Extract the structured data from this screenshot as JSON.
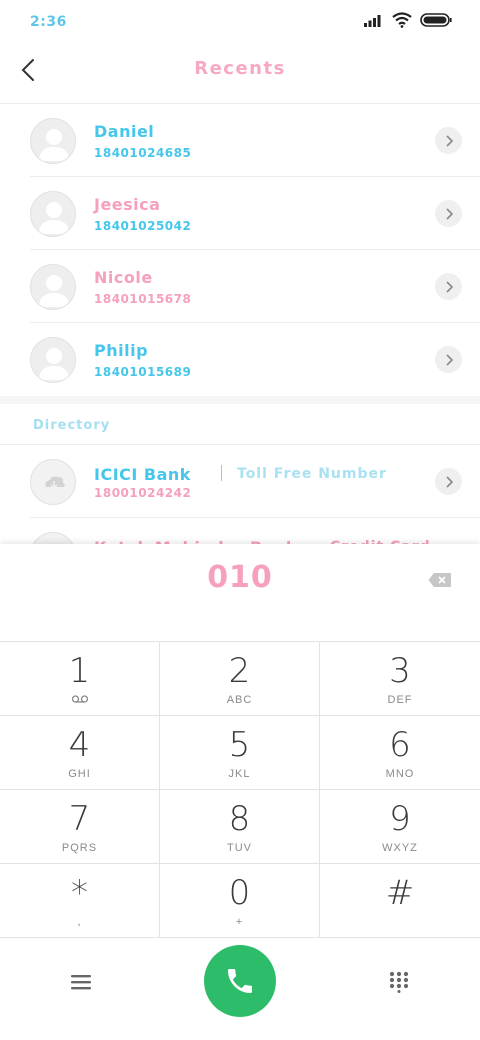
{
  "status_bar": {
    "time": "2:36"
  },
  "header": {
    "title": "Recents"
  },
  "recents": [
    {
      "name": "Daniel",
      "number": "18401024685",
      "name_color": "blue",
      "number_color": "blue"
    },
    {
      "name": "Jeesica",
      "number": "18401025042",
      "name_color": "pink",
      "number_color": "blue"
    },
    {
      "name": "Nicole",
      "number": "18401015678",
      "name_color": "pink",
      "number_color": "pink"
    },
    {
      "name": "Philip",
      "number": "18401015689",
      "name_color": "blue",
      "number_color": "blue"
    }
  ],
  "directory": {
    "label": "Directory",
    "items": [
      {
        "name": "ICICI Bank",
        "tag": "Toll Free Number",
        "number": "18001024242"
      }
    ],
    "partial_item": {
      "name": "Kotak Mahindra Bank",
      "tag": "Credit Card"
    }
  },
  "dialer": {
    "input": "010",
    "keys": [
      {
        "num": "1",
        "sub": ""
      },
      {
        "num": "2",
        "sub": "ABC"
      },
      {
        "num": "3",
        "sub": "DEF"
      },
      {
        "num": "4",
        "sub": "GHI"
      },
      {
        "num": "5",
        "sub": "JKL"
      },
      {
        "num": "6",
        "sub": "MNO"
      },
      {
        "num": "7",
        "sub": "PQRS"
      },
      {
        "num": "8",
        "sub": "TUV"
      },
      {
        "num": "9",
        "sub": "WXYZ"
      },
      {
        "num": "*",
        "sub": ","
      },
      {
        "num": "0",
        "sub": "+"
      },
      {
        "num": "#",
        "sub": ""
      }
    ]
  },
  "colors": {
    "accent_blue": "#45c6ea",
    "accent_pink": "#f6a0bd",
    "call_green": "#2dbd6a"
  },
  "icons": [
    "signal-icon",
    "wifi-icon",
    "battery-icon",
    "back-icon",
    "chevron-right-icon",
    "avatar-icon",
    "cloud-icon",
    "backspace-icon",
    "voicemail-icon",
    "menu-icon",
    "phone-icon",
    "keypad-grid-icon"
  ]
}
